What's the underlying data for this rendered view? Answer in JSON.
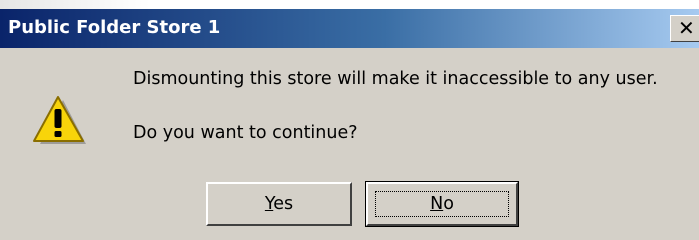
{
  "window": {
    "title": "Public Folder Store 1",
    "close_glyph": "✕"
  },
  "dialog": {
    "icon": "warning-icon",
    "message_line1": "Dismounting this store will make it inaccessible to any user.",
    "message_line2": "Do you want to continue?"
  },
  "buttons": {
    "yes": {
      "mnemonic": "Y",
      "rest": "es"
    },
    "no": {
      "mnemonic": "N",
      "rest": "o"
    }
  },
  "colors": {
    "titlebar_start": "#0a246a",
    "titlebar_end": "#a6caf0",
    "dialog_bg": "#d4d0c8",
    "warning_yellow": "#f8d40a"
  }
}
